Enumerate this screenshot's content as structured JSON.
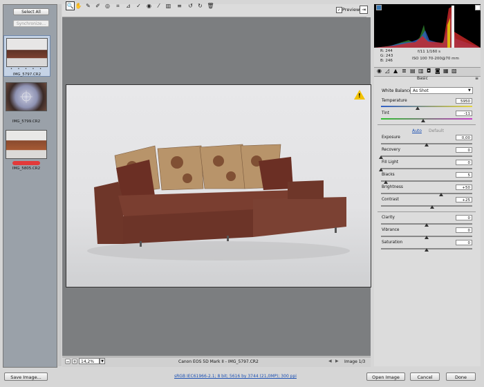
{
  "filmstrip": {
    "select_all": "Select All",
    "synchronize": "Synchronize...",
    "images": [
      {
        "name": "IMG_5797.CR2",
        "stars": "• • • • •",
        "selected": true
      },
      {
        "name": "IMG_5799.CR2",
        "stars": "",
        "selected": false
      },
      {
        "name": "IMG_5805.CR2",
        "stars": "",
        "selected": false,
        "label_color": "#e23a3a"
      }
    ]
  },
  "toolbar": {
    "preview_label": "Preview",
    "preview_checked": true
  },
  "warning_icon_glyph": "!",
  "status": {
    "zoom": "14,2%",
    "camera": "Canon EOS 5D Mark II  -  IMG_5797.CR2",
    "image_counter": "Image 1/3"
  },
  "readout": {
    "r": "R:  244",
    "g": "G:  243",
    "b": "B:  246",
    "aperture_shutter": "f/11    1/160 s",
    "iso_lens": "ISO 100    70-200@70 mm"
  },
  "panel": {
    "section_title": "Basic",
    "white_balance_label": "White Balance:",
    "white_balance_value": "As Shot",
    "auto": "Auto",
    "default": "Default",
    "sliders": [
      {
        "label": "Temperature",
        "value": "5950",
        "level": 0.4
      },
      {
        "label": "Tint",
        "value": "-11",
        "level": 0.46
      },
      {
        "label": "Exposure",
        "value": "0,00",
        "level": 0.5
      },
      {
        "label": "Recovery",
        "value": "0",
        "level": 0.0
      },
      {
        "label": "Fill Light",
        "value": "0",
        "level": 0.0
      },
      {
        "label": "Blacks",
        "value": "5",
        "level": 0.05
      },
      {
        "label": "Brightness",
        "value": "+50",
        "level": 0.66
      },
      {
        "label": "Contrast",
        "value": "+25",
        "level": 0.56
      },
      {
        "label": "Clarity",
        "value": "0",
        "level": 0.5
      },
      {
        "label": "Vibrance",
        "value": "0",
        "level": 0.5
      },
      {
        "label": "Saturation",
        "value": "0",
        "level": 0.5
      }
    ]
  },
  "footer": {
    "save": "Save Image...",
    "workflow_link": "sRGB IEC61966-2.1; 8 bit; 5616 by 3744 (21,0MP); 300 ppi",
    "open": "Open Image",
    "cancel": "Cancel",
    "done": "Done"
  }
}
